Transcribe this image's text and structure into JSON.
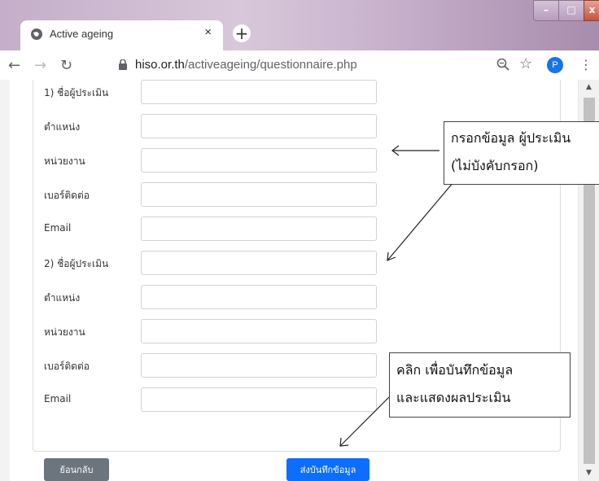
{
  "browser": {
    "tab_title": "Active ageing",
    "tab_close": "×",
    "new_tab": "+",
    "url_host": "hiso.or.th",
    "url_path": "/activeageing/questionnaire.php",
    "profile_initial": "P",
    "window_controls": {
      "minimize": "–",
      "maximize": "□",
      "close": "x"
    }
  },
  "form": {
    "rows": [
      {
        "label": "1) ชื่อผู้ประเมิน",
        "value": ""
      },
      {
        "label": "ตำแหน่ง",
        "value": ""
      },
      {
        "label": "หน่วยงาน",
        "value": ""
      },
      {
        "label": "เบอร์ติดต่อ",
        "value": ""
      },
      {
        "label": "Email",
        "value": ""
      },
      {
        "label": "2) ชื่อผู้ประเมิน",
        "value": ""
      },
      {
        "label": "ตำแหน่ง",
        "value": ""
      },
      {
        "label": "หน่วยงาน",
        "value": ""
      },
      {
        "label": "เบอร์ติดต่อ",
        "value": ""
      },
      {
        "label": "Email",
        "value": ""
      }
    ],
    "back_button": "ย้อนกลับ",
    "submit_button": "ส่งบันทึกข้อมูล"
  },
  "annotations": {
    "callout1_line1": "กรอกข้อมูล ผู้ประเมิน",
    "callout1_line2": "(ไม่บังคับกรอก)",
    "callout2_line1": "คลิก เพื่อบันทึกข้อมูล",
    "callout2_line2": "และแสดงผลประเมิน"
  },
  "colors": {
    "submit": "#0d6efd",
    "back": "#6c757d",
    "profile": "#1a73e8"
  }
}
